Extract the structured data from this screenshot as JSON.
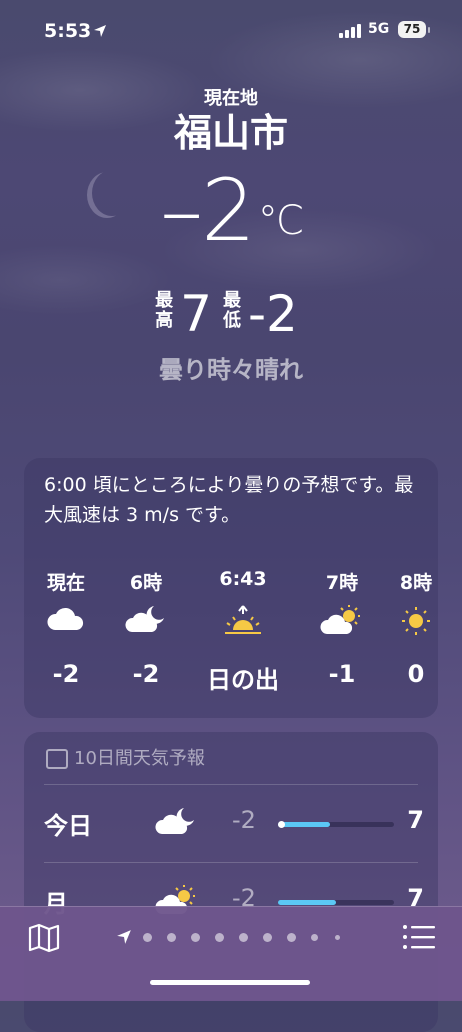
{
  "status": {
    "time": "5:53",
    "network": "5G",
    "battery": "75"
  },
  "location": {
    "label": "現在地",
    "city": "福山市"
  },
  "current": {
    "temp": "–2",
    "unit": "°C",
    "high_label": "最高",
    "high": "7",
    "low_label": "最低",
    "low": "-2",
    "condition": "曇り時々晴れ"
  },
  "hourly": {
    "summary": "6:00 頃にところにより曇りの予想です。最大風速は 3 m/s です。",
    "items": [
      {
        "label": "現在",
        "icon": "cloud-icon",
        "value": "-2"
      },
      {
        "label": "6時",
        "icon": "cloud-moon-icon",
        "value": "-2"
      },
      {
        "label": "6:43",
        "icon": "sunrise-icon",
        "value": "日の出"
      },
      {
        "label": "7時",
        "icon": "cloud-sun-icon",
        "value": "-1"
      },
      {
        "label": "8時",
        "icon": "sun-icon",
        "value": "0"
      }
    ]
  },
  "daily": {
    "title": "10日間天気予報",
    "days": [
      {
        "name": "今日",
        "icon": "cloud-moon-icon",
        "low": "-2",
        "high": "7",
        "bar_start": 0.0,
        "bar_end": 0.45,
        "current_marker": 0.0
      },
      {
        "name": "月",
        "icon": "cloud-sun-icon",
        "low": "-2",
        "high": "7",
        "bar_start": 0.0,
        "bar_end": 0.5
      }
    ]
  },
  "colors": {
    "bar": "#5bc8f5",
    "sun": "#f6c945"
  }
}
